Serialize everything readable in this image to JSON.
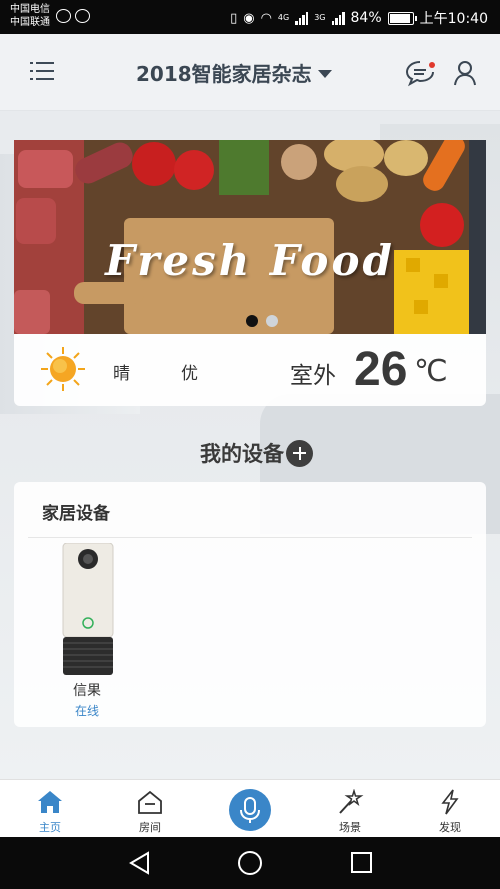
{
  "status_bar": {
    "carrier1": "中国电信",
    "carrier2": "中国联通",
    "net1": "4G",
    "net2": "3G",
    "battery": "84%",
    "battery_level": 0.84,
    "time": "上午10:40"
  },
  "header": {
    "home_name": "2018智能家居杂志"
  },
  "banner": {
    "text": "Fresh Food",
    "slides": 2,
    "active_slide": 1
  },
  "weather": {
    "condition": "晴",
    "air_quality": "优",
    "label": "室外",
    "temperature": "26",
    "unit": "℃"
  },
  "devices_section": {
    "title": "我的设备"
  },
  "device_card": {
    "title": "家居设备",
    "devices": [
      {
        "name": "信果",
        "status": "在线"
      }
    ]
  },
  "bottom_nav": {
    "items": [
      {
        "label": "主页",
        "icon": "home-icon"
      },
      {
        "label": "房间",
        "icon": "room-icon"
      },
      {
        "label": "",
        "icon": "microphone-icon"
      },
      {
        "label": "场景",
        "icon": "scene-wand-icon"
      },
      {
        "label": "发现",
        "icon": "lightning-icon"
      }
    ]
  },
  "colors": {
    "accent": "#3a86c8",
    "header_text": "#3b4753",
    "status_bar": "#0a0a0a"
  }
}
